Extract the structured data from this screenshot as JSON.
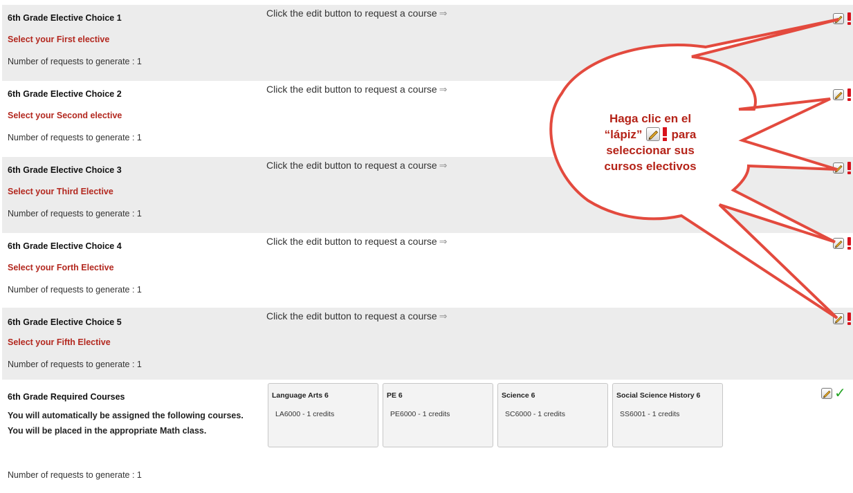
{
  "electives": [
    {
      "title": "6th Grade Elective Choice 1",
      "subtitle": "Select your First elective",
      "count_text": "Number of requests to generate : 1",
      "hint": "Click the edit button to request a course"
    },
    {
      "title": "6th Grade Elective Choice 2",
      "subtitle": "Select your Second elective",
      "count_text": "Number of requests to generate : 1",
      "hint": "Click the edit button to request a course"
    },
    {
      "title": "6th Grade Elective Choice 3",
      "subtitle": "Select your Third Elective",
      "count_text": "Number of requests to generate : 1",
      "hint": "Click the edit button to request a course"
    },
    {
      "title": "6th Grade Elective Choice 4",
      "subtitle": "Select your Forth Elective",
      "count_text": "Number of requests to generate : 1",
      "hint": "Click the edit button to request a course"
    },
    {
      "title": "6th Grade Elective Choice 5",
      "subtitle": "Select your Fifth Elective",
      "count_text": "Number of requests to generate : 1",
      "hint": "Click the edit button to request a course"
    }
  ],
  "required": {
    "title": "6th Grade Required Courses",
    "description": "You will automatically be assigned the following courses. You will be placed in the appropriate Math class.",
    "count_text": "Number of requests to generate : 1",
    "courses": [
      {
        "name": "Language Arts 6",
        "code": "LA6000 - 1 credits"
      },
      {
        "name": "PE 6",
        "code": "PE6000 - 1 credits"
      },
      {
        "name": "Science 6",
        "code": "SC6000 - 1 credits"
      },
      {
        "name": "Social Science History 6",
        "code": "SS6001 - 1 credits"
      }
    ]
  },
  "callout": {
    "line1": "Haga clic en el",
    "line2_before": "“lápiz”",
    "line2_after": "para",
    "line3": "seleccionar sus",
    "line4": "cursos electivos"
  },
  "icons": {
    "row_arrow": "arrow-right-icon",
    "edit": "pencil-icon",
    "incomplete": "exclamation-icon",
    "complete": "checkmark-icon"
  },
  "colors": {
    "row_shaded": "#ececec",
    "subtitle_red": "#b3281f",
    "callout_stroke": "#e34a3e",
    "callout_text": "#b52318",
    "alert_red": "#d8121c",
    "check_green": "#22a322"
  }
}
